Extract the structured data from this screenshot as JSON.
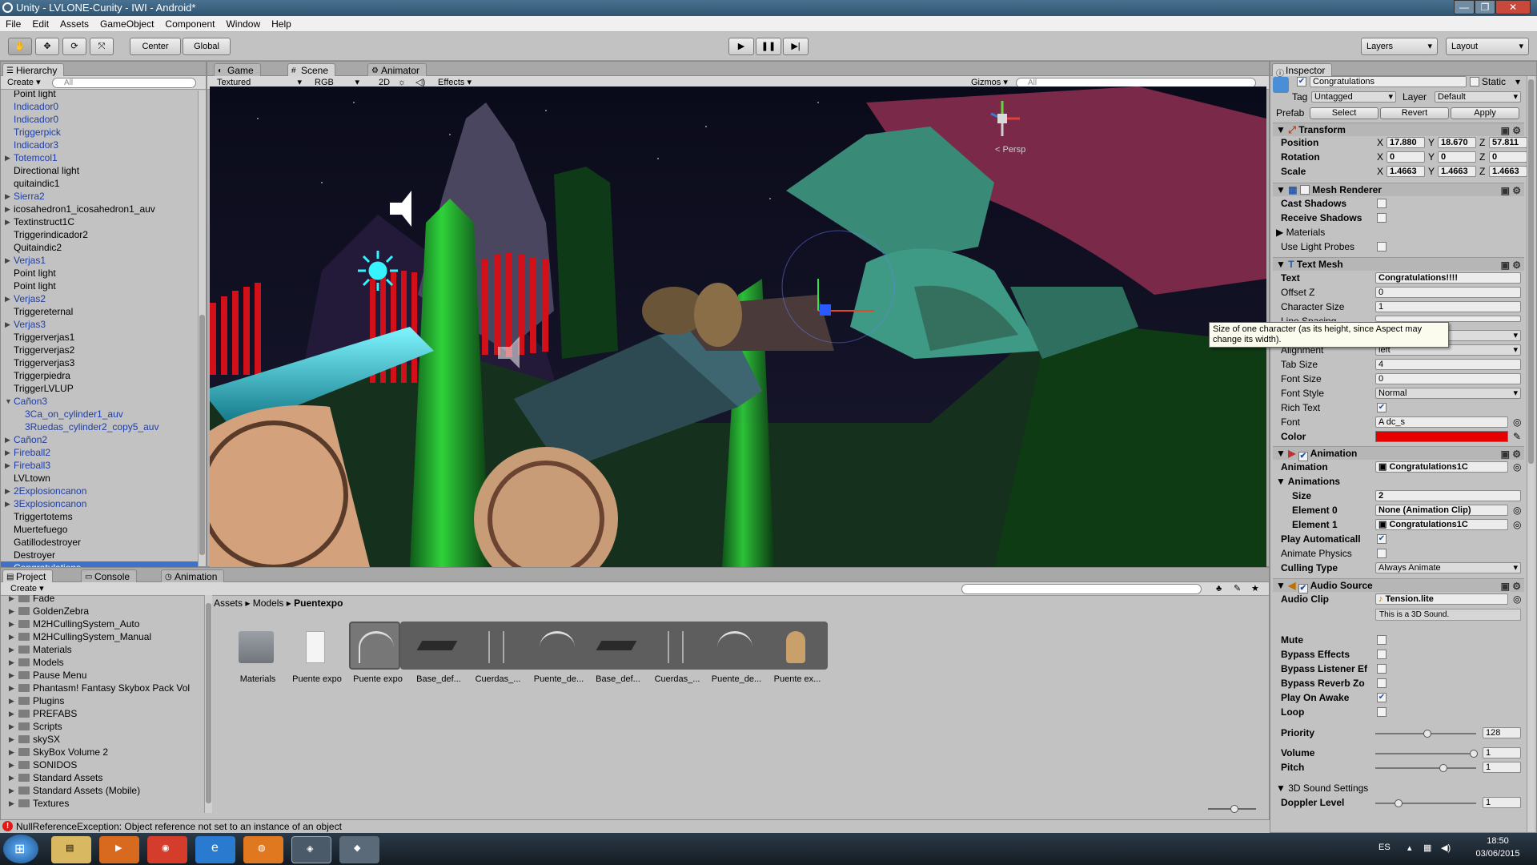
{
  "window": {
    "title": "Unity - LVLONE-Cunity - IWI - Android*",
    "controls": [
      "—",
      "❐",
      "✕"
    ]
  },
  "menu": [
    "File",
    "Edit",
    "Assets",
    "GameObject",
    "Component",
    "Window",
    "Help"
  ],
  "toolbar": {
    "center": "Center",
    "global": "Global",
    "layers": "Layers",
    "layout": "Layout"
  },
  "hierarchy": {
    "tab": "Hierarchy",
    "create": "Create",
    "search_placeholder": "All",
    "items": [
      {
        "label": "Point light",
        "blue": false,
        "arrow": false,
        "indent": 0
      },
      {
        "label": "Indicador0",
        "blue": true,
        "arrow": false,
        "indent": 0
      },
      {
        "label": "Indicador0",
        "blue": true,
        "arrow": false,
        "indent": 0
      },
      {
        "label": "Triggerpick",
        "blue": true,
        "arrow": false,
        "indent": 0
      },
      {
        "label": "Indicador3",
        "blue": true,
        "arrow": false,
        "indent": 0
      },
      {
        "label": "Totemcol1",
        "blue": true,
        "arrow": true,
        "indent": 0
      },
      {
        "label": "Directional light",
        "blue": false,
        "arrow": false,
        "indent": 0
      },
      {
        "label": "quitaindic1",
        "blue": false,
        "arrow": false,
        "indent": 0
      },
      {
        "label": "Sierra2",
        "blue": true,
        "arrow": true,
        "indent": 0
      },
      {
        "label": "icosahedron1_icosahedron1_auv",
        "blue": false,
        "arrow": true,
        "indent": 0
      },
      {
        "label": "Textinstruct1C",
        "blue": false,
        "arrow": true,
        "indent": 0
      },
      {
        "label": "Triggerindicador2",
        "blue": false,
        "arrow": false,
        "indent": 0
      },
      {
        "label": "Quitaindic2",
        "blue": false,
        "arrow": false,
        "indent": 0
      },
      {
        "label": "Verjas1",
        "blue": true,
        "arrow": true,
        "indent": 0
      },
      {
        "label": "Point light",
        "blue": false,
        "arrow": false,
        "indent": 0
      },
      {
        "label": "Point light",
        "blue": false,
        "arrow": false,
        "indent": 0
      },
      {
        "label": "Verjas2",
        "blue": true,
        "arrow": true,
        "indent": 0
      },
      {
        "label": "Triggereternal",
        "blue": false,
        "arrow": false,
        "indent": 0
      },
      {
        "label": "Verjas3",
        "blue": true,
        "arrow": true,
        "indent": 0
      },
      {
        "label": "Triggerverjas1",
        "blue": false,
        "arrow": false,
        "indent": 0
      },
      {
        "label": "Triggerverjas2",
        "blue": false,
        "arrow": false,
        "indent": 0
      },
      {
        "label": "Triggerverjas3",
        "blue": false,
        "arrow": false,
        "indent": 0
      },
      {
        "label": "Triggerpiedra",
        "blue": false,
        "arrow": false,
        "indent": 0
      },
      {
        "label": "TriggerLVLUP",
        "blue": false,
        "arrow": false,
        "indent": 0
      },
      {
        "label": "Cañon3",
        "blue": true,
        "arrow": "open",
        "indent": 0
      },
      {
        "label": "3Ca_on_cylinder1_auv",
        "blue": true,
        "arrow": false,
        "indent": 1
      },
      {
        "label": "3Ruedas_cylinder2_copy5_auv",
        "blue": true,
        "arrow": false,
        "indent": 1
      },
      {
        "label": "Cañon2",
        "blue": true,
        "arrow": true,
        "indent": 0
      },
      {
        "label": "Fireball2",
        "blue": true,
        "arrow": true,
        "indent": 0
      },
      {
        "label": "Fireball3",
        "blue": true,
        "arrow": true,
        "indent": 0
      },
      {
        "label": "LVLtown",
        "blue": false,
        "arrow": false,
        "indent": 0
      },
      {
        "label": "2Explosioncanon",
        "blue": true,
        "arrow": true,
        "indent": 0
      },
      {
        "label": "3Explosioncanon",
        "blue": true,
        "arrow": true,
        "indent": 0
      },
      {
        "label": "Triggertotems",
        "blue": false,
        "arrow": false,
        "indent": 0
      },
      {
        "label": "Muertefuego",
        "blue": false,
        "arrow": false,
        "indent": 0
      },
      {
        "label": "Gatillodestroyer",
        "blue": false,
        "arrow": false,
        "indent": 0
      },
      {
        "label": "Destroyer",
        "blue": false,
        "arrow": false,
        "indent": 0
      },
      {
        "label": "Congratulations",
        "blue": false,
        "arrow": false,
        "indent": 0,
        "selected": true
      }
    ]
  },
  "scene": {
    "tabs": [
      "Game",
      "Scene",
      "Animator"
    ],
    "active_tab": "Scene",
    "shading": "Textured",
    "render": "RGB",
    "twod": "2D",
    "effects": "Effects",
    "gizmos": "Gizmos",
    "search_placeholder": "All",
    "persp": "< Persp"
  },
  "bottom": {
    "tabs": [
      "Project",
      "Console",
      "Animation"
    ],
    "create": "Create",
    "folders": [
      "Fade",
      "GoldenZebra",
      "M2HCullingSystem_Auto",
      "M2HCullingSystem_Manual",
      "Materials",
      "Models",
      "Pause Menu",
      "Phantasm! Fantasy Skybox Pack Vol",
      "Plugins",
      "PREFABS",
      "Scripts",
      "skySX",
      "SkyBox Volume 2",
      "SONIDOS",
      "Standard Assets",
      "Standard Assets (Mobile)",
      "Textures"
    ],
    "breadcrumb": [
      "Assets",
      "Models",
      "Puentexpo"
    ],
    "assets": [
      "Materials",
      "Puente expo",
      "Puente expo",
      "Base_def...",
      "Cuerdas_...",
      "Puente_de...",
      "Base_def...",
      "Cuerdas_...",
      "Puente_de...",
      "Puente ex..."
    ]
  },
  "inspector": {
    "tab": "Inspector",
    "object_name": "Congratulations",
    "static": "Static",
    "tag_label": "Tag",
    "tag": "Untagged",
    "layer_label": "Layer",
    "layer": "Default",
    "prefab": "Prefab",
    "select": "Select",
    "revert": "Revert",
    "apply": "Apply",
    "transform": {
      "title": "Transform",
      "position": {
        "label": "Position",
        "x": "17.880",
        "y": "18.670",
        "z": "57.811"
      },
      "rotation": {
        "label": "Rotation",
        "x": "0",
        "y": "0",
        "z": "0"
      },
      "scale": {
        "label": "Scale",
        "x": "1.4663",
        "y": "1.4663",
        "z": "1.4663"
      }
    },
    "mesh_renderer": {
      "title": "Mesh Renderer",
      "cast_shadows": "Cast Shadows",
      "receive_shadows": "Receive Shadows",
      "materials": "Materials",
      "use_light_probes": "Use Light Probes"
    },
    "text_mesh": {
      "title": "Text Mesh",
      "text_label": "Text",
      "text": "Congratulations!!!!",
      "offset_z_label": "Offset Z",
      "offset_z": "0",
      "char_size_label": "Character Size",
      "char_size": "1",
      "line_spacing_label": "Line Spacing",
      "line_spacing": "1",
      "alignment_label": "Alignment",
      "alignment": "left",
      "tab_size_label": "Tab Size",
      "tab_size": "4",
      "font_size_label": "Font Size",
      "font_size": "0",
      "font_style_label": "Font Style",
      "font_style": "Normal",
      "rich_text_label": "Rich Text",
      "font_label": "Font",
      "font": "dc_s",
      "color_label": "Color",
      "color": "#e60000"
    },
    "tooltip": "Size of one character (as its height, since Aspect may change its width).",
    "animation": {
      "title": "Animation",
      "animation_label": "Animation",
      "animation": "Congratulations1C",
      "animations_label": "Animations",
      "size_label": "Size",
      "size": "2",
      "el0_label": "Element 0",
      "el0": "None (Animation Clip)",
      "el1_label": "Element 1",
      "el1": "Congratulations1C",
      "play_auto": "Play Automaticall",
      "animate_physics": "Animate Physics",
      "culling_label": "Culling Type",
      "culling": "Always Animate"
    },
    "audio": {
      "title": "Audio Source",
      "clip_label": "Audio Clip",
      "clip": "Tension.lite",
      "note": "This is a 3D Sound.",
      "mute": "Mute",
      "bypass_effects": "Bypass Effects",
      "bypass_listener": "Bypass Listener Ef",
      "bypass_reverb": "Bypass Reverb Zo",
      "play_on_awake": "Play On Awake",
      "loop": "Loop",
      "priority_label": "Priority",
      "priority": "128",
      "volume_label": "Volume",
      "volume": "1",
      "pitch_label": "Pitch",
      "pitch": "1",
      "settings3d": "3D Sound Settings",
      "doppler_label": "Doppler Level",
      "doppler": "1"
    }
  },
  "status": {
    "error": "NullReferenceException: Object reference not set to an instance of an object"
  },
  "taskbar": {
    "lang": "ES",
    "time": "18:50",
    "date": "03/06/2015"
  }
}
